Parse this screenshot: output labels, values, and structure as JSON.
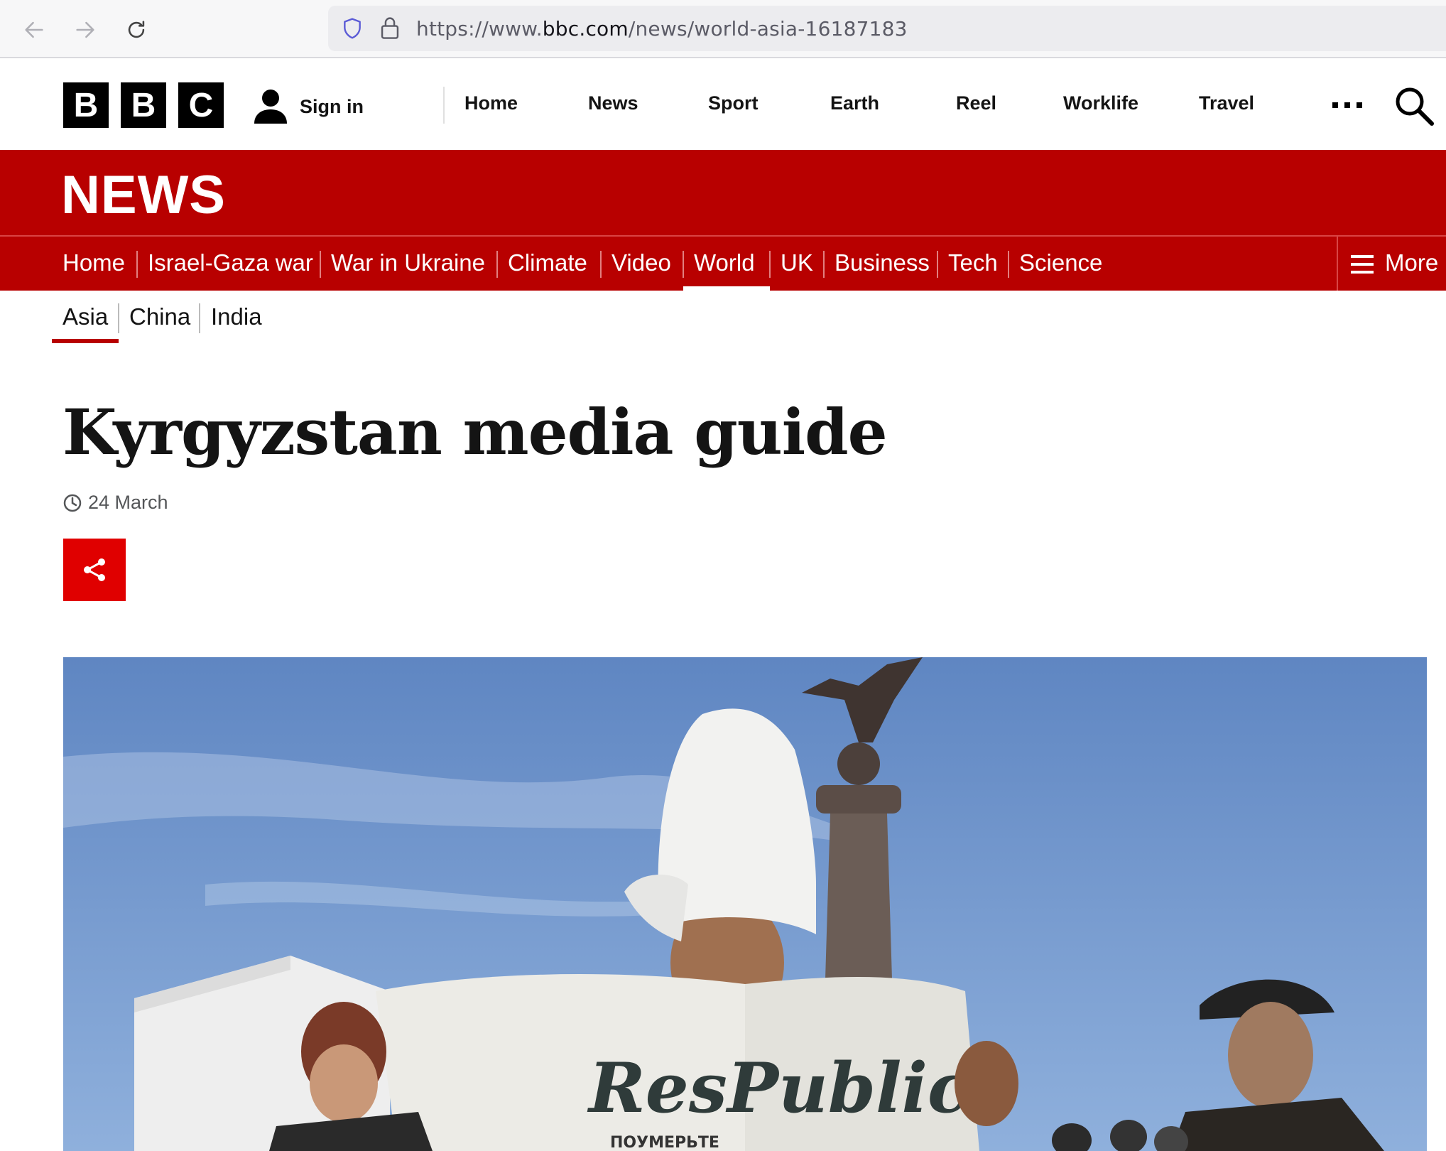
{
  "browser": {
    "url_prefix": "https://www.",
    "url_host": "bbc.com",
    "url_path": "/news/world-asia-16187183"
  },
  "bbc_header": {
    "logo_letters": [
      "B",
      "B",
      "C"
    ],
    "sign_in_label": "Sign in",
    "nav_items": [
      "Home",
      "News",
      "Sport",
      "Earth",
      "Reel",
      "Worklife",
      "Travel"
    ]
  },
  "news_banner": {
    "title": "NEWS"
  },
  "section_nav": {
    "items": [
      "Home",
      "Israel-Gaza war",
      "War in Ukraine",
      "Climate",
      "Video",
      "World",
      "UK",
      "Business",
      "Tech",
      "Science"
    ],
    "active": "World",
    "more_label": "More"
  },
  "sub_nav": {
    "items": [
      "Asia",
      "China",
      "India"
    ],
    "active": "Asia"
  },
  "article": {
    "headline": "Kyrgyzstan media guide",
    "timestamp": "24 March"
  },
  "hero_image": {
    "newspaper_masthead": "ResPublica",
    "newspaper_footer": "ПОУМЕРЬТЕ"
  },
  "colors": {
    "bbc_red": "#b80000",
    "share_red": "#e00000",
    "sky_blue": "#6f93c9"
  }
}
